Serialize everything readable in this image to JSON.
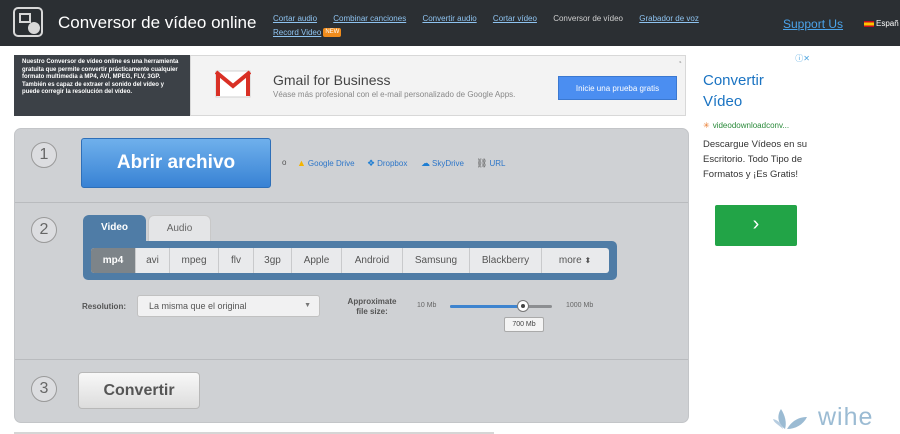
{
  "header": {
    "site_title": "Conversor de vídeo online",
    "nav": [
      {
        "label": "Cortar audio"
      },
      {
        "label": "Combinar canciones"
      },
      {
        "label": "Convertir audio"
      },
      {
        "label": "Cortar vídeo"
      },
      {
        "label": "Conversor de vídeo",
        "current": true
      },
      {
        "label": "Grabador de voz"
      },
      {
        "label": "Record Video",
        "badge": "NEW"
      }
    ],
    "support_label": "Support Us",
    "language": "Españ"
  },
  "description": "Nuestro Conversor de vídeo online es una herramienta gratuita que permite convertir prácticamente cualquier formato multimedia a MP4, AVI, MPEG, FLV, 3GP. También es capaz de extraer el sonido del vídeo y puede corregir la resolución del vídeo.",
  "gmail_ad": {
    "title": "Gmail for Business",
    "subtitle": "Véase más profesional con el e-mail personalizado de Google Apps.",
    "button": "Inicie una prueba gratis"
  },
  "steps": {
    "step1": {
      "number": "1",
      "open_button": "Abrir archivo",
      "or": "o",
      "sources": [
        {
          "label": "Google Drive",
          "icon": "google-drive-icon",
          "color": "#f4b400"
        },
        {
          "label": "Dropbox",
          "icon": "dropbox-icon",
          "color": "#1f7ed3"
        },
        {
          "label": "SkyDrive",
          "icon": "skydrive-icon",
          "color": "#1f7ed3"
        },
        {
          "label": "URL",
          "icon": "link-icon",
          "color": "#555555"
        }
      ]
    },
    "step2": {
      "number": "2",
      "tabs": [
        "Video",
        "Audio"
      ],
      "formats": [
        "mp4",
        "avi",
        "mpeg",
        "flv",
        "3gp",
        "Apple",
        "Android",
        "Samsung",
        "Blackberry",
        "more"
      ],
      "selected_format": "mp4",
      "resolution_label": "Resolution:",
      "resolution_value": "La misma que el original",
      "size_label": "Approximate file size:",
      "size_min": "10 Mb",
      "size_max": "1000 Mb",
      "size_value": "700 Mb",
      "size_fraction": 0.72
    },
    "step3": {
      "number": "3",
      "convert_button": "Convertir"
    }
  },
  "right_ad": {
    "title": "Convertir Vídeo",
    "url": "videodownloadconv...",
    "body": "Descargue Vídeos en su Escritorio. Todo Tipo de Formatos y ¡Es Gratis!"
  },
  "watermark": "wihe",
  "colors": {
    "header_bg": "#2b2f33",
    "accent_blue": "#4f7ca6",
    "open_button": "#3882d4",
    "ad_green": "#22a447"
  }
}
